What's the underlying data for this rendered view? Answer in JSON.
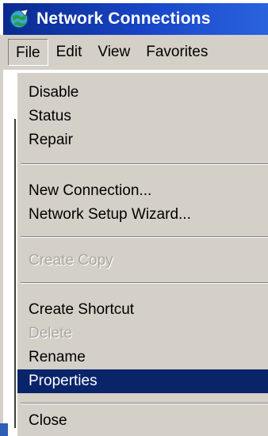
{
  "window": {
    "title": "Network Connections",
    "icon": "network-connections-icon",
    "title_color": "#0a2a8f"
  },
  "menubar": {
    "items": [
      {
        "label": "File",
        "active": true
      },
      {
        "label": "Edit",
        "active": false
      },
      {
        "label": "View",
        "active": false
      },
      {
        "label": "Favorites",
        "active": false
      }
    ]
  },
  "file_menu": {
    "items": [
      {
        "label": "Disable",
        "enabled": true
      },
      {
        "label": "Status",
        "enabled": true
      },
      {
        "label": "Repair",
        "enabled": true
      },
      {
        "label": "New Connection...",
        "enabled": true
      },
      {
        "label": "Network Setup Wizard...",
        "enabled": true
      },
      {
        "label": "Create Copy",
        "enabled": false
      },
      {
        "label": "Create Shortcut",
        "enabled": true
      },
      {
        "label": "Delete",
        "enabled": false
      },
      {
        "label": "Rename",
        "enabled": true
      },
      {
        "label": "Properties",
        "enabled": true,
        "selected": true
      },
      {
        "label": "Close",
        "enabled": true
      }
    ],
    "selection_color": "#0a246a"
  }
}
